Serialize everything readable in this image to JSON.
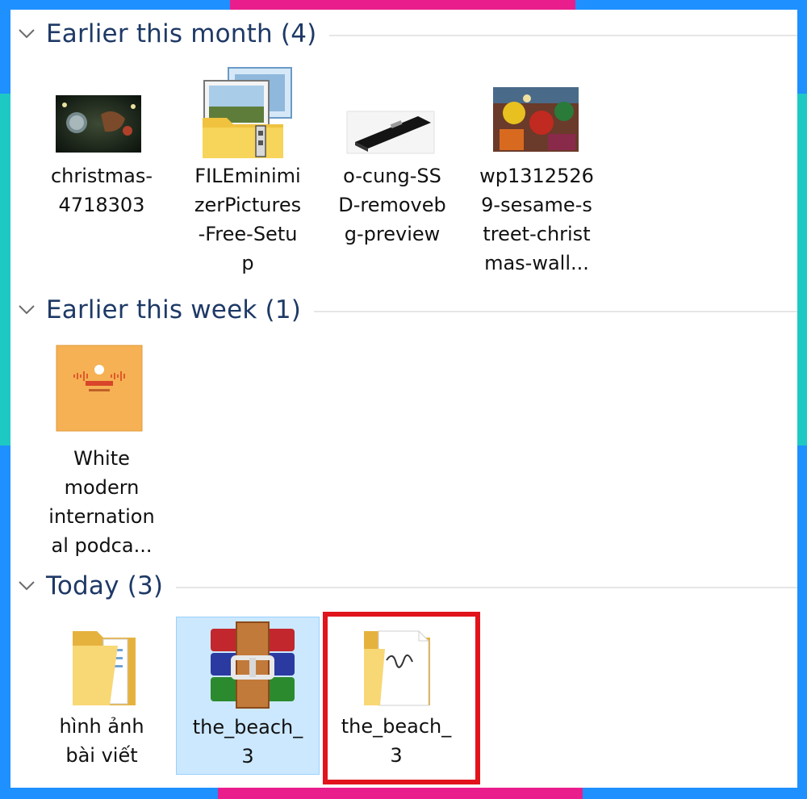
{
  "groups": [
    {
      "title": "Earlier this month (4)",
      "items": [
        {
          "name": "christmas-\n4718303",
          "icon": "image-thumbnail-icon"
        },
        {
          "name": "FILEminimi\nzerPictures\n-Free-Setu\np",
          "icon": "installer-icon"
        },
        {
          "name": "o-cung-SS\nD-removeb\ng-preview",
          "icon": "image-thumbnail-icon"
        },
        {
          "name": "wp1312526\n9-sesame-s\ntreet-christ\nmas-wall...",
          "icon": "image-thumbnail-icon"
        }
      ]
    },
    {
      "title": "Earlier this week (1)",
      "items": [
        {
          "name": "White\nmodern\ninternation\nal podca...",
          "icon": "image-thumbnail-icon"
        }
      ]
    },
    {
      "title": "Today (3)",
      "items": [
        {
          "name": "hình ảnh\nbài viết",
          "icon": "folder-icon"
        },
        {
          "name": "the_beach_\n3",
          "icon": "winrar-archive-icon",
          "selected": true
        },
        {
          "name": "the_beach_\n3",
          "icon": "folder-icon",
          "highlighted": true
        }
      ]
    }
  ],
  "colors": {
    "group_title": "#1e3966",
    "selection_bg": "#cce8ff",
    "highlight": "#e1141c",
    "frame_blue": "#1e90ff",
    "frame_pink": "#e91e8c",
    "frame_teal": "#1ec9c4"
  }
}
